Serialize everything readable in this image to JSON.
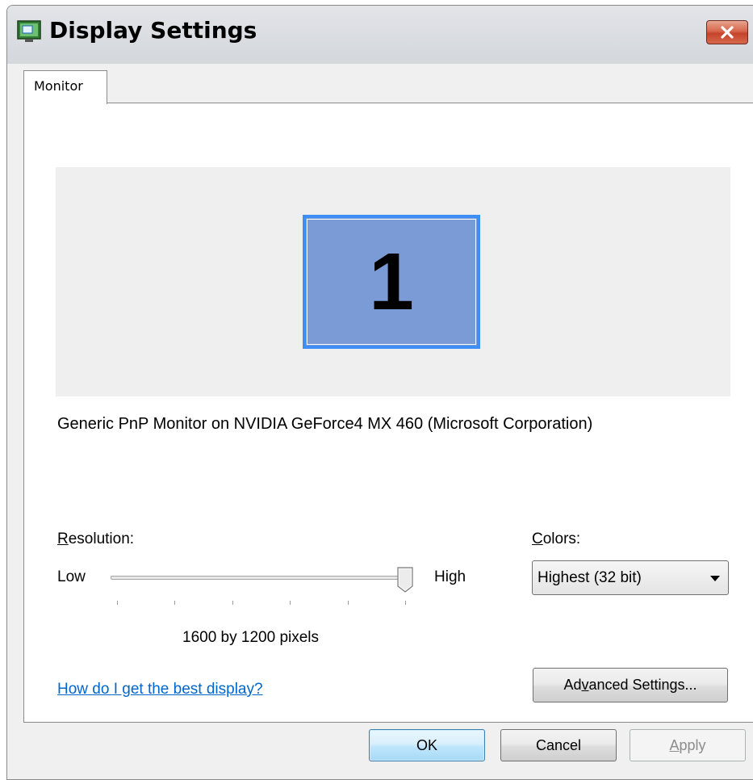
{
  "window": {
    "title": "Display Settings"
  },
  "tabs": [
    {
      "label": "Monitor",
      "selected": true
    }
  ],
  "monitor": {
    "number": "1",
    "description": "Generic PnP Monitor on NVIDIA GeForce4 MX 460 (Microsoft Corporation)"
  },
  "resolution": {
    "label_accel": "R",
    "label_rest": "esolution:",
    "low_label": "Low",
    "high_label": "High",
    "value_text": "1600 by 1200 pixels",
    "slider_level": 1.0,
    "tick_count": 6
  },
  "colors": {
    "label_accel": "C",
    "label_rest": "olors:",
    "selected": "Highest (32 bit)"
  },
  "help_link": "How do I get the best display?",
  "buttons": {
    "advanced_pre": "Ad",
    "advanced_accel": "v",
    "advanced_post": "anced Settings...",
    "ok": "OK",
    "cancel": "Cancel",
    "apply_accel": "A",
    "apply_rest": "pply"
  },
  "colors_theme": {
    "monitor_fill": "#7b9bd6",
    "monitor_border": "#3d8ef5",
    "link": "#0066cc"
  }
}
